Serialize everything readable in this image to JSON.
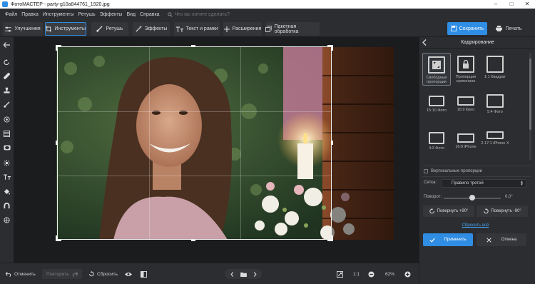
{
  "window": {
    "title": "ФотоМАСТЕР - party-g10a844761_1920.jpg",
    "minimize": "–",
    "maximize": "□",
    "close": "✕"
  },
  "menu": {
    "items": [
      "Файл",
      "Правка",
      "Инструменты",
      "Ретушь",
      "Эффекты",
      "Вид",
      "Справка"
    ],
    "search_placeholder": "Что вы хотите сделать?"
  },
  "toolbar": {
    "tabs": [
      "Улучшения",
      "Инструменты",
      "Ретушь",
      "Эффекты",
      "Текст и рамки",
      "Расширения",
      "Пакетная обработка"
    ],
    "active_tab": "Инструменты",
    "save_label": "Сохранить",
    "print_label": "Печать"
  },
  "panel": {
    "title": "Кадрирование",
    "presets": [
      {
        "label": "Свободные пропорции",
        "active": true
      },
      {
        "label": "Пропорции оригинала",
        "active": false
      },
      {
        "label": "1:1 Квадрат",
        "active": false
      },
      {
        "label": "15:10 Фото",
        "active": false
      },
      {
        "label": "16:9 Кино",
        "active": false
      },
      {
        "label": "5:4 Фото",
        "active": false
      },
      {
        "label": "4:3 Фото",
        "active": false
      },
      {
        "label": "16:9 iPhone",
        "active": false
      },
      {
        "label": "2.17:1 iPhone X",
        "active": false
      }
    ],
    "vertical_label": "Вертикальные пропорции",
    "grid_label": "Сетка:",
    "grid_value": "Правило третей",
    "rotate_label": "Поворот:",
    "rotate_value": "0,0°",
    "rotate_fraction": 0.5,
    "rotate_plus": "Повернуть +90°",
    "rotate_minus": "Повернуть -90°",
    "reset_all": "Сбросить всё",
    "apply": "Применить",
    "cancel": "Отмена"
  },
  "bottom": {
    "undo": "Отменить",
    "redo": "Повторить",
    "reset": "Сбросить",
    "ratio": "1:1",
    "zoom": "62%"
  },
  "colors": {
    "accent": "#2f8de4",
    "background": "#2b2d30",
    "canvas": "#1b1c1e"
  }
}
